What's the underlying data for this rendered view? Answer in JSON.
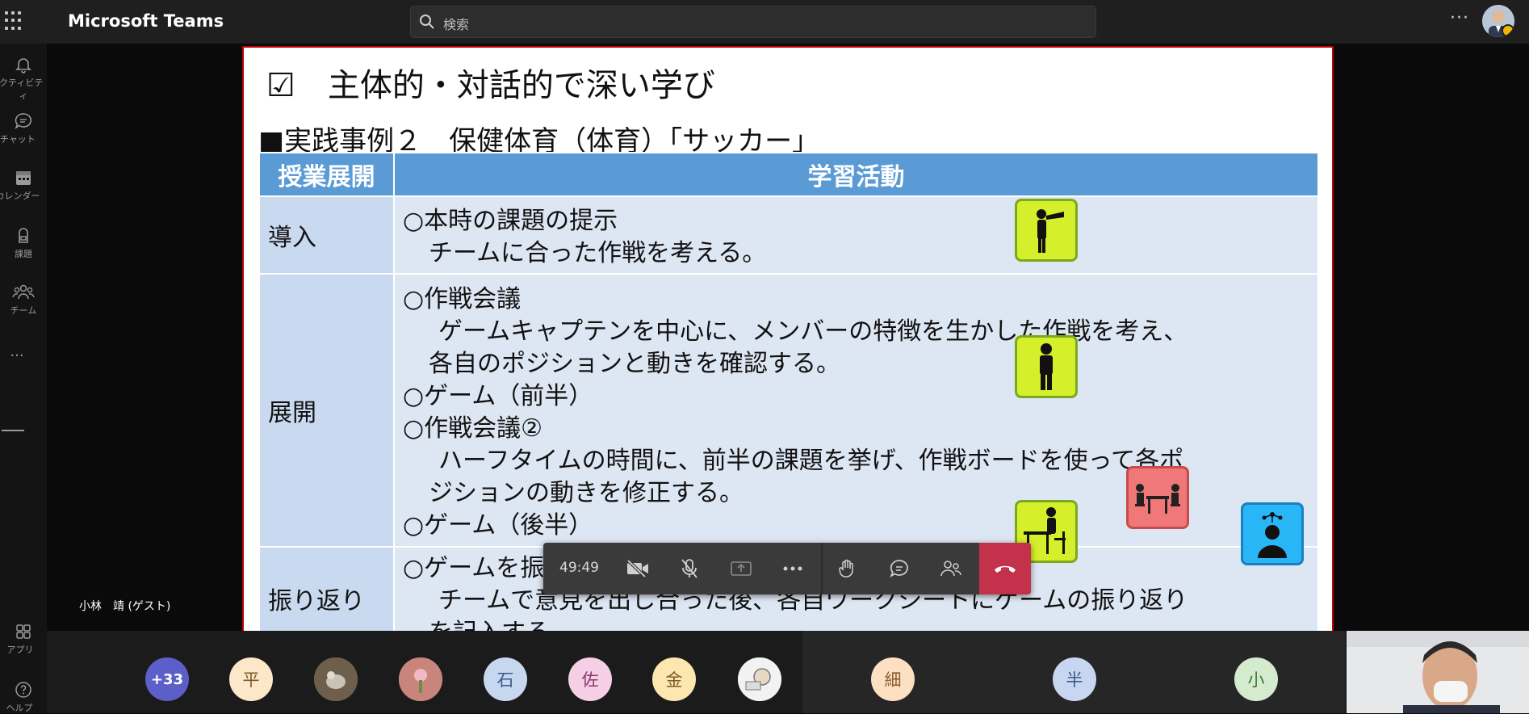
{
  "app": {
    "title": "Microsoft Teams"
  },
  "search": {
    "placeholder": "検索"
  },
  "rail": {
    "items": [
      {
        "label": "アクティビティ",
        "icon": "bell-icon"
      },
      {
        "label": "チャット",
        "icon": "chat-icon"
      },
      {
        "label": "カレンダー",
        "icon": "calendar-icon"
      },
      {
        "label": "課題",
        "icon": "backpack-icon"
      },
      {
        "label": "チーム",
        "icon": "teams-icon"
      }
    ],
    "more": "···",
    "bottom": [
      {
        "label": "アプリ",
        "icon": "apps-icon"
      },
      {
        "label": "ヘルプ",
        "icon": "help-icon"
      }
    ]
  },
  "slide": {
    "title": "☑　主体的・対話的で深い学び",
    "subtitle": "■実践事例２　保健体育（体育）「サッカー」",
    "table": {
      "headers": [
        "授業展開",
        "学習活動"
      ],
      "rows": [
        {
          "phase": "導入",
          "lines": [
            "○本時の課題の提示",
            "チームに合った作戦を考える。"
          ]
        },
        {
          "phase": "展開",
          "lines": [
            "○作戦会議",
            "ゲームキャプテンを中心に、メンバーの特徴を生かした作戦を考え、",
            "各自のポジションと動きを確認する。",
            "○ゲーム（前半）",
            "○作戦会議②",
            "ハーフタイムの時間に、前半の課題を挙げ、作戦ボードを使って各ポ",
            "ジションの動きを修正する。",
            "○ゲーム（後半）"
          ]
        },
        {
          "phase": "振り返り",
          "lines": [
            "○ゲームを振り返る",
            "チームで意見を出し合った後、各自ワークシートにゲームの振り返り",
            "を記入する。"
          ]
        }
      ]
    },
    "pictograms": [
      "telescope-person-icon",
      "standing-person-icon",
      "discussion-table-icon",
      "desk-writing-icon",
      "thinking-person-icon"
    ]
  },
  "call": {
    "timer": "49:49",
    "self_name": "小林　靖 (ゲスト)"
  },
  "participants": {
    "overflow": "+33",
    "avatars": [
      {
        "initial": "平",
        "bg": "#fde7c9"
      },
      {
        "initial": "",
        "bg": "#7a6a58"
      },
      {
        "initial": "",
        "bg": "#d4978f"
      },
      {
        "initial": "石",
        "bg": "#c7d7f0"
      },
      {
        "initial": "佐",
        "bg": "#f4cfe6"
      },
      {
        "initial": "金",
        "bg": "#fde7b0"
      },
      {
        "initial": "",
        "bg": "#f0f0f0"
      },
      {
        "initial": "細",
        "bg": "#fde0c2"
      },
      {
        "initial": "半",
        "bg": "#c9d6f2"
      },
      {
        "initial": "小",
        "bg": "#d5ebcf"
      }
    ]
  },
  "colors": {
    "accent": "#5b5fc7",
    "hangup": "#c4314b",
    "table_header": "#5b9bd5",
    "slide_border": "#c00000"
  }
}
